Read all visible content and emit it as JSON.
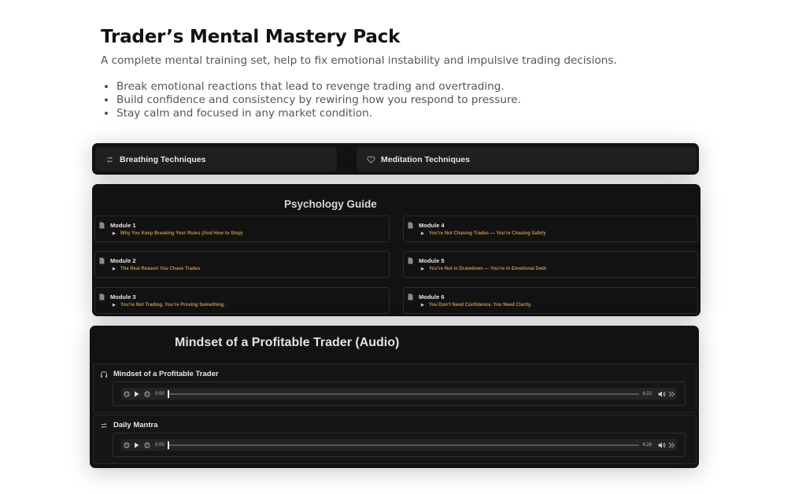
{
  "hero": {
    "title": "Trader’s Mental Mastery Pack",
    "subtitle": "A complete mental training set, help to fix emotional instability and impulsive trading decisions.",
    "bullets": [
      "Break emotional reactions that lead to revenge trading and overtrading.",
      "Build confidence and consistency by rewiring how you respond to pressure.",
      "Stay calm and focused in any market condition."
    ]
  },
  "tabs": [
    {
      "label": "Breathing Techniques",
      "icon": "repeat-icon"
    },
    {
      "label": "Meditation Techniques",
      "icon": "heart-icon"
    }
  ],
  "guide": {
    "title": "Psychology Guide",
    "modules": [
      {
        "label": "Module 1",
        "subtitle": "Why You Keep Breaking Your Rules (And How to Stop)"
      },
      {
        "label": "Module 2",
        "subtitle": "The Real Reason You Chase Trades"
      },
      {
        "label": "Module 3",
        "subtitle": "You’re Not Trading. You’re Proving Something."
      },
      {
        "label": "Module 4",
        "subtitle": "You’re Not Chasing Trades — You’re Chasing Safety"
      },
      {
        "label": "Module 5",
        "subtitle": "You’re Not in Drawdown — You’re in Emotional Debt"
      },
      {
        "label": "Module 6",
        "subtitle": "You Don’t Need Confidence. You Need Clarity."
      }
    ]
  },
  "audio": {
    "title": "Mindset of a Profitable Trader (Audio)",
    "tracks": [
      {
        "title": "Mindset of a Profitable Trader",
        "icon": "headphones-icon",
        "current": "0:00",
        "duration": "8:22",
        "progress": 0
      },
      {
        "title": "Daily Mantra",
        "icon": "repeat-icon",
        "current": "0:00",
        "duration": "4:26",
        "progress": 0
      }
    ]
  },
  "colors": {
    "panel": "#121212",
    "accent": "#c8913a"
  }
}
